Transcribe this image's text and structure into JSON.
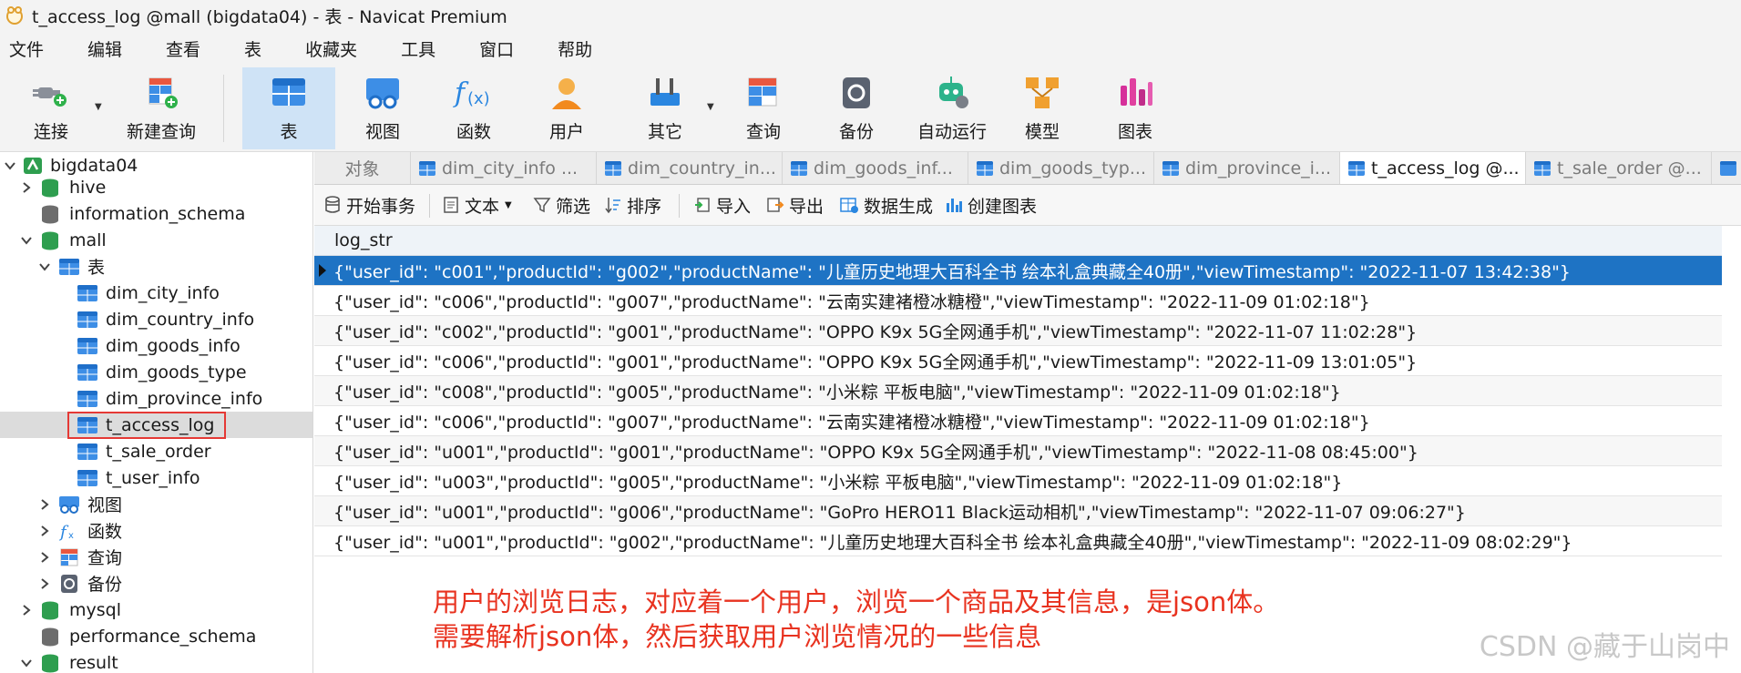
{
  "window": {
    "title": "t_access_log @mall (bigdata04) - 表 - Navicat Premium"
  },
  "menu": [
    "文件",
    "编辑",
    "查看",
    "表",
    "收藏夹",
    "工具",
    "窗口",
    "帮助"
  ],
  "toolbar": {
    "connect": "连接",
    "new_query": "新建查询",
    "table": "表",
    "view": "视图",
    "function": "函数",
    "user": "用户",
    "other": "其它",
    "query": "查询",
    "backup": "备份",
    "auto_run": "自动运行",
    "model": "模型",
    "chart": "图表"
  },
  "sidebar": {
    "connection": "bigdata04",
    "db_hive": "hive",
    "db_information_schema": "information_schema",
    "db_mall": "mall",
    "tables_folder": "表",
    "tables": [
      "dim_city_info",
      "dim_country_info",
      "dim_goods_info",
      "dim_goods_type",
      "dim_province_info",
      "t_access_log",
      "t_sale_order",
      "t_user_info"
    ],
    "views_folder": "视图",
    "functions_folder": "函数",
    "queries_folder": "查询",
    "backups_folder": "备份",
    "db_mysql": "mysql",
    "db_performance_schema": "performance_schema",
    "db_result": "result"
  },
  "tabs": [
    "对象",
    "dim_city_info ...",
    "dim_country_in...",
    "dim_goods_inf...",
    "dim_goods_typ...",
    "dim_province_i...",
    "t_access_log @...",
    "t_sale_order @..."
  ],
  "data_toolbar": {
    "begin_transaction": "开始事务",
    "text": "文本",
    "filter": "筛选",
    "sort": "排序",
    "import": "导入",
    "export": "导出",
    "data_generation": "数据生成",
    "create_chart": "创建图表"
  },
  "grid": {
    "column": "log_str",
    "rows": [
      "{\"user_id\": \"c001\",\"productId\": \"g002\",\"productName\": \"儿童历史地理大百科全书 绘本礼盒典藏全40册\",\"viewTimestamp\": \"2022-11-07 13:42:38\"}",
      "{\"user_id\": \"c006\",\"productId\": \"g007\",\"productName\": \"云南实建褚橙冰糖橙\",\"viewTimestamp\": \"2022-11-09 01:02:18\"}",
      "{\"user_id\": \"c002\",\"productId\": \"g001\",\"productName\": \"OPPO K9x 5G全网通手机\",\"viewTimestamp\": \"2022-11-07 11:02:28\"}",
      "{\"user_id\": \"c006\",\"productId\": \"g001\",\"productName\": \"OPPO K9x 5G全网通手机\",\"viewTimestamp\": \"2022-11-09 13:01:05\"}",
      "{\"user_id\": \"c008\",\"productId\": \"g005\",\"productName\": \"小米粽 平板电脑\",\"viewTimestamp\": \"2022-11-09 01:02:18\"}",
      "{\"user_id\": \"c006\",\"productId\": \"g007\",\"productName\": \"云南实建褚橙冰糖橙\",\"viewTimestamp\": \"2022-11-09 01:02:18\"}",
      "{\"user_id\": \"u001\",\"productId\": \"g001\",\"productName\": \"OPPO K9x 5G全网通手机\",\"viewTimestamp\": \"2022-11-08 08:45:00\"}",
      "{\"user_id\": \"u003\",\"productId\": \"g005\",\"productName\": \"小米粽 平板电脑\",\"viewTimestamp\": \"2022-11-09 01:02:18\"}",
      "{\"user_id\": \"u001\",\"productId\": \"g006\",\"productName\": \"GoPro HERO11 Black运动相机\",\"viewTimestamp\": \"2022-11-07 09:06:27\"}",
      "{\"user_id\": \"u001\",\"productId\": \"g002\",\"productName\": \"儿童历史地理大百科全书 绘本礼盒典藏全40册\",\"viewTimestamp\": \"2022-11-09 08:02:29\"}"
    ]
  },
  "annotation": {
    "line1": "用户的浏览日志，对应着一个用户，浏览一个商品及其信息，是json体。",
    "line2": "需要解析json体，然后获取用户浏览情况的一些信息"
  },
  "watermark": "CSDN @藏于山岗中",
  "colors": {
    "accent": "#1e73c4",
    "annotation": "#e8321f",
    "highlight_box": "#e53935",
    "db_green": "#2e9e4f",
    "table_blue": "#2a86e0"
  }
}
